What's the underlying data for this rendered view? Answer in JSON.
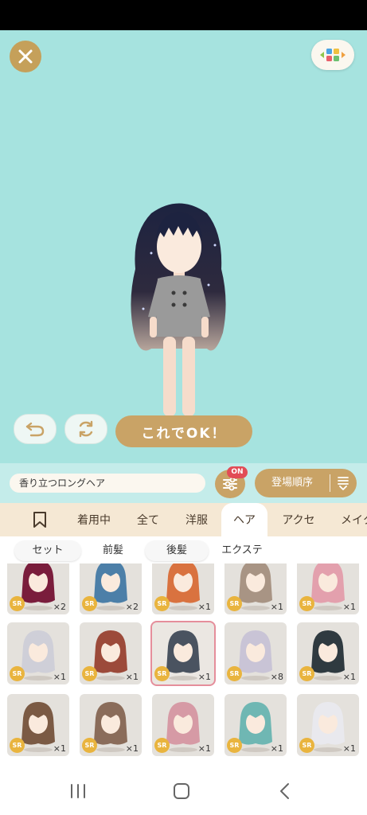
{
  "header": {
    "close_icon": "close-icon",
    "menu_icon": "tiles-icon"
  },
  "actions": {
    "undo_icon": "undo-icon",
    "reset_icon": "refresh-icon",
    "ok_label": "これでOK！"
  },
  "info": {
    "item_name": "香り立つロングヘア",
    "filter_badge": "ON",
    "sort_label": "登場順序"
  },
  "tabs": {
    "bookmark_icon": "bookmark-icon",
    "items": [
      "着用中",
      "全て",
      "洋服",
      "ヘア",
      "アクセ",
      "メイク"
    ],
    "active": "ヘア"
  },
  "subtabs": {
    "items": [
      "セット",
      "前髪",
      "後髪",
      "エクステ"
    ],
    "active": "後髪"
  },
  "grid": {
    "rarity_label": "SR",
    "items": [
      {
        "count": "×2",
        "color": "#7a1d3c"
      },
      {
        "count": "×2",
        "color": "#4c7fa8"
      },
      {
        "count": "×1",
        "color": "#d9723f"
      },
      {
        "count": "×1",
        "color": "#a89484"
      },
      {
        "count": "×1",
        "color": "#e3a0ad"
      },
      {
        "count": "×1",
        "color": "#cfcfd8"
      },
      {
        "count": "×1",
        "color": "#9c4a3a"
      },
      {
        "count": "×1",
        "color": "#4a5360"
      },
      {
        "count": "×8",
        "color": "#c9c4d6"
      },
      {
        "count": "×1",
        "color": "#2f3a40"
      },
      {
        "count": "×1",
        "color": "#7b5a44"
      },
      {
        "count": "×1",
        "color": "#8a6c5a"
      },
      {
        "count": "×1",
        "color": "#d69aa5"
      },
      {
        "count": "×1",
        "color": "#6fb7b3"
      },
      {
        "count": "×1",
        "color": "#e9e9ee"
      }
    ],
    "selected_index": 7
  },
  "navbar": {
    "recent_icon": "recent-apps-icon",
    "home_icon": "home-icon",
    "back_icon": "back-icon"
  }
}
